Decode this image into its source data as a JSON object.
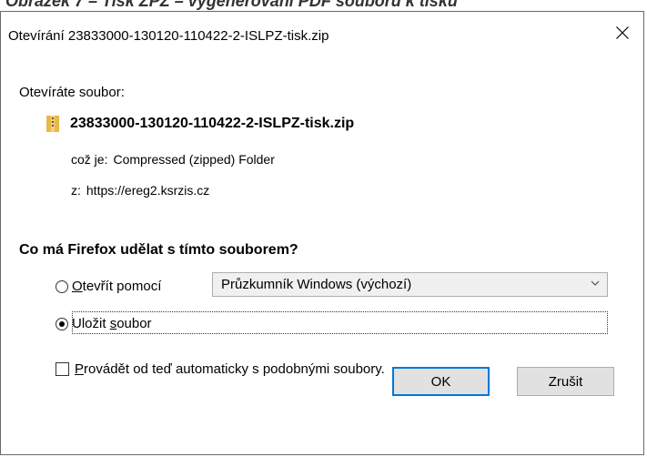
{
  "background_caption": "Obrázek 7 – Tisk ZPZ – vygenerování PDF souboru k tisku",
  "dialog": {
    "title": "Otevírání 23833000-130120-110422-2-ISLPZ-tisk.zip",
    "close_glyph": "✕"
  },
  "content": {
    "opening_label": "Otevíráte soubor:",
    "file_name": "23833000-130120-110422-2-ISLPZ-tisk.zip",
    "file_icon": "zip-folder-icon",
    "type_key": "což je:",
    "type_value": "Compressed (zipped) Folder",
    "from_key": "z:",
    "from_value": "https://ereg2.ksrzis.cz",
    "question": "Co má Firefox udělat s tímto souborem?"
  },
  "options": {
    "open_with": {
      "label_u": "O",
      "label_rest": "tevřít pomocí",
      "checked": false
    },
    "app_select": {
      "value": "Průzkumník Windows (výchozí)"
    },
    "save_file": {
      "label_pre": "Uložit ",
      "label_u": "s",
      "label_rest": "oubor",
      "checked": true
    },
    "auto": {
      "label_u": "P",
      "label_rest": "rovádět od teď automaticky s podobnými soubory.",
      "checked": false
    }
  },
  "buttons": {
    "ok": "OK",
    "cancel": "Zrušit"
  },
  "colors": {
    "default_button_border": "#0078d7",
    "button_bg": "#e1e1e1",
    "zip_icon_yellow": "#e8b84a"
  }
}
